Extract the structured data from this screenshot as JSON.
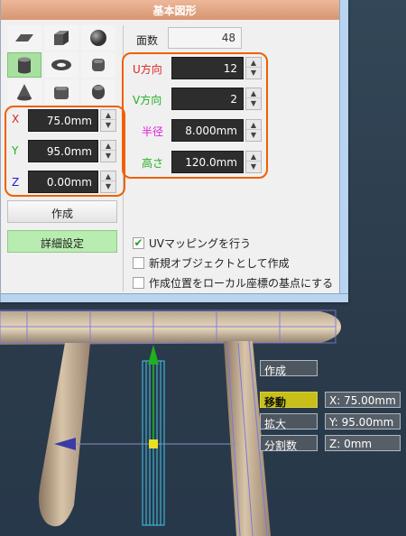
{
  "dialog": {
    "title": "基本図形",
    "faces": {
      "label": "面数",
      "value": "48"
    },
    "u_dir": {
      "label": "U方向",
      "value": "12"
    },
    "v_dir": {
      "label": "V方向",
      "value": "2"
    },
    "radius": {
      "label": "半径",
      "value": "8.000mm"
    },
    "height": {
      "label": "高さ",
      "value": "120.0mm"
    },
    "pos_x": {
      "label": "X",
      "value": "75.0mm"
    },
    "pos_y": {
      "label": "Y",
      "value": "95.0mm"
    },
    "pos_z": {
      "label": "Z",
      "value": "0.00mm"
    },
    "create_button": "作成",
    "detail_button": "詳細設定",
    "options": [
      {
        "label": "UVマッピングを行う",
        "checked": true
      },
      {
        "label": "新規オブジェクトとして作成",
        "checked": false
      },
      {
        "label": "作成位置をローカル座標の基点にする",
        "checked": false
      }
    ],
    "shapes": [
      "plane-icon",
      "cube-icon",
      "sphere-icon",
      "cylinder-icon",
      "torus-icon",
      "rounded-cube-icon",
      "cone-icon",
      "rounded-box-icon",
      "capsule-icon"
    ],
    "selected_shape": "cylinder-icon"
  },
  "hud": {
    "create": "作成",
    "move": "移動",
    "scale": "拡大",
    "divisions": "分割数",
    "x_readout": "X: 75.00mm",
    "y_readout": "Y: 95.00mm",
    "z_readout": "Z: 0mm"
  },
  "colors": {
    "title_bar": "#dc9a76",
    "highlight": "#f06000",
    "selected_shape": "#a8e0a0",
    "detail_button": "#b8ecb0",
    "u_label": "#e02020",
    "v_label": "#20b020",
    "radius_label": "#e020e0",
    "height_label": "#20b020",
    "x_label": "#e02020",
    "y_label": "#20b020",
    "z_label": "#2020d0",
    "hud_active": "#c8c018"
  }
}
